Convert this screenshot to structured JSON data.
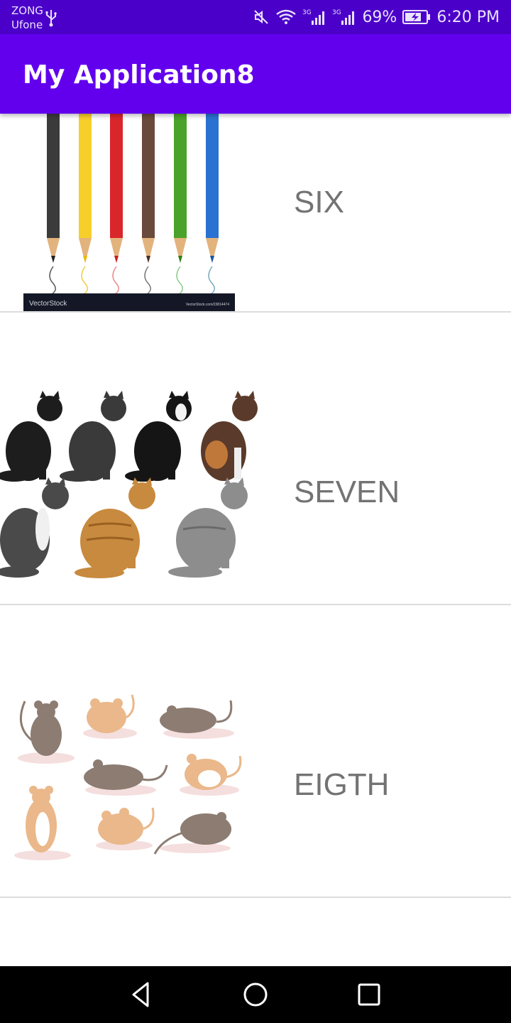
{
  "status_bar": {
    "carrier_1": "ZONG",
    "carrier_2": "Ufone",
    "battery": "69%",
    "time": "6:20 PM",
    "signal_1": "3G",
    "signal_2": "3G"
  },
  "app_bar": {
    "title": "My Application8"
  },
  "list": {
    "items": [
      {
        "label": "SIX",
        "watermark_left": "VectorStock",
        "watermark_right": "VectorStock.com/23814474"
      },
      {
        "label": "SEVEN"
      },
      {
        "label": "EIGTH"
      }
    ]
  },
  "colors": {
    "status_bar": "#4b00c9",
    "app_bar": "#6200ee",
    "label_text": "#737373",
    "divider": "#dcdcdc"
  }
}
